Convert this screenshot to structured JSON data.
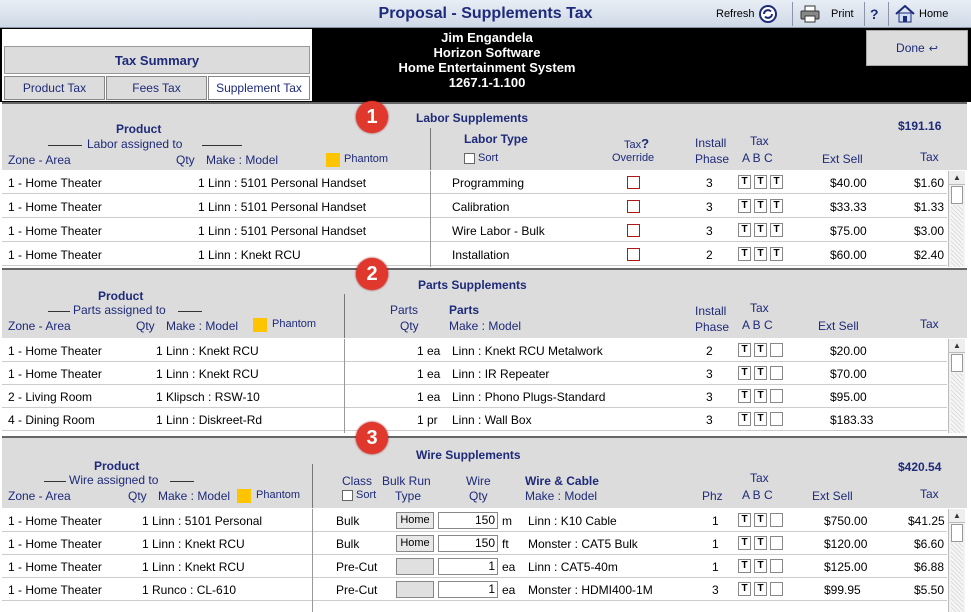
{
  "window": {
    "title": "Proposal - Supplements Tax",
    "refresh": "Refresh",
    "print": "Print",
    "help": "?",
    "home": "Home",
    "done": "Done"
  },
  "tax_summary": {
    "title": "Tax Summary",
    "tabs": [
      "Product Tax",
      "Fees Tax",
      "Supplement Tax"
    ]
  },
  "client": {
    "name": "Jim Engandela",
    "company": "Horizon Software",
    "project": "Home Entertainment System",
    "version": "1267.1-1.100"
  },
  "labor": {
    "badge": "1",
    "title": "Labor Supplements",
    "total": "$191.16",
    "headers": {
      "product": "Product",
      "assigned": "Labor assigned to",
      "zone": "Zone - Area",
      "qty": "Qty",
      "make": "Make : Model",
      "phantom": "Phantom",
      "labor_type": "Labor Type",
      "sort": "Sort",
      "tax_q": "Tax",
      "override": "Override",
      "install": "Install",
      "phase": "Phase",
      "tax": "Tax",
      "abc": "A B C",
      "ext_sell": "Ext Sell",
      "tax_col": "Tax"
    },
    "rows": [
      {
        "zone": "1 - Home Theater",
        "product": "1 Linn : 5101 Personal Handset",
        "type": "Programming",
        "phase": "3",
        "ext": "$40.00",
        "tax": "$1.60"
      },
      {
        "zone": "1 - Home Theater",
        "product": "1 Linn : 5101 Personal Handset",
        "type": "Calibration",
        "phase": "3",
        "ext": "$33.33",
        "tax": "$1.33"
      },
      {
        "zone": "1 - Home Theater",
        "product": "1 Linn : 5101 Personal Handset",
        "type": "Wire Labor - Bulk",
        "phase": "3",
        "ext": "$75.00",
        "tax": "$3.00"
      },
      {
        "zone": "1 - Home Theater",
        "product": "1 Linn : Knekt RCU",
        "type": "Installation",
        "phase": "2",
        "ext": "$60.00",
        "tax": "$2.40"
      }
    ]
  },
  "parts": {
    "badge": "2",
    "title": "Parts Supplements",
    "headers": {
      "product": "Product",
      "assigned": "Parts assigned to",
      "zone": "Zone - Area",
      "qty": "Qty",
      "make": "Make : Model",
      "phantom": "Phantom",
      "parts": "Parts",
      "parts_qty": "Qty",
      "parts_col": "Parts",
      "parts_make": "Make : Model",
      "install": "Install",
      "phase": "Phase",
      "tax": "Tax",
      "abc": "A B C",
      "ext_sell": "Ext Sell",
      "tax_col": "Tax"
    },
    "rows": [
      {
        "zone": "1 - Home Theater",
        "product": "1 Linn : Knekt RCU",
        "qty": "1 ea",
        "part": "Linn : Knekt RCU Metalwork",
        "phase": "2",
        "ext": "$20.00"
      },
      {
        "zone": "1 - Home Theater",
        "product": "1 Linn : Knekt RCU",
        "qty": "1 ea",
        "part": "Linn : IR Repeater",
        "phase": "3",
        "ext": "$70.00"
      },
      {
        "zone": "2 - Living Room",
        "product": "1 Klipsch : RSW-10",
        "qty": "1 ea",
        "part": "Linn : Phono Plugs-Standard",
        "phase": "3",
        "ext": "$95.00"
      },
      {
        "zone": "4 - Dining Room",
        "product": "1 Linn : Diskreet-Rd",
        "qty": "1 pr",
        "part": "Linn : Wall Box",
        "phase": "3",
        "ext": "$183.33"
      }
    ]
  },
  "wire": {
    "badge": "3",
    "title": "Wire Supplements",
    "total": "$420.54",
    "headers": {
      "product": "Product",
      "assigned": "Wire assigned to",
      "zone": "Zone - Area",
      "qty": "Qty",
      "make": "Make : Model",
      "phantom": "Phantom",
      "class": "Class",
      "bulk_run": "Bulk Run",
      "sort": "Sort",
      "type": "Type",
      "wire": "Wire",
      "wire_qty": "Qty",
      "wire_cable": "Wire & Cable",
      "wire_make": "Make : Model",
      "phz": "Phz",
      "tax": "Tax",
      "abc": "A B C",
      "ext_sell": "Ext Sell",
      "tax_col": "Tax"
    },
    "rows": [
      {
        "zone": "1 - Home Theater",
        "product": "1 Linn : 5101 Personal",
        "class": "Bulk",
        "run": "Home",
        "qty": "150",
        "unit": "m",
        "cable": "Linn : K10 Cable",
        "phz": "1",
        "ext": "$750.00",
        "tax": "$41.25"
      },
      {
        "zone": "1 - Home Theater",
        "product": "1 Linn : Knekt RCU",
        "class": "Bulk",
        "run": "Home",
        "qty": "150",
        "unit": "ft",
        "cable": "Monster : CAT5 Bulk",
        "phz": "1",
        "ext": "$120.00",
        "tax": "$6.60"
      },
      {
        "zone": "1 - Home Theater",
        "product": "1 Linn : Knekt RCU",
        "class": "Pre-Cut",
        "run": "",
        "qty": "1",
        "unit": "ea",
        "cable": "Linn : CAT5-40m",
        "phz": "1",
        "ext": "$125.00",
        "tax": "$6.88"
      },
      {
        "zone": "1 - Home Theater",
        "product": "1 Runco : CL-610",
        "class": "Pre-Cut",
        "run": "",
        "qty": "1",
        "unit": "ea",
        "cable": "Monster : HDMI400-1M",
        "phz": "3",
        "ext": "$99.95",
        "tax": "$5.50"
      }
    ]
  },
  "tax_letters": {
    "t": "T"
  },
  "colors": {
    "accent": "#1e2a7a",
    "badge": "#e0382c",
    "phantom": "#ffc400"
  }
}
